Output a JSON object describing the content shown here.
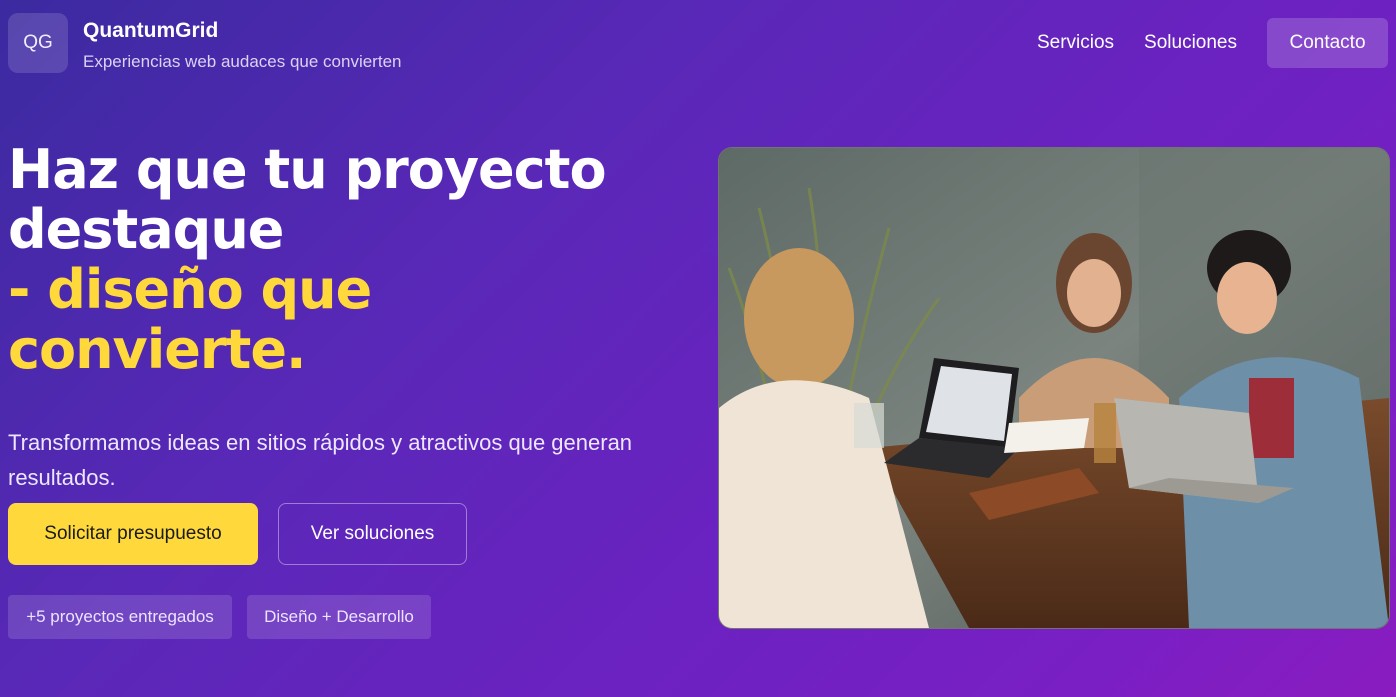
{
  "brand": {
    "logo_text": "QG",
    "name": "QuantumGrid",
    "tagline": "Experiencias web audaces que convierten"
  },
  "nav": {
    "items": [
      "Servicios",
      "Soluciones"
    ],
    "contact_label": "Contacto"
  },
  "hero": {
    "title_line1": "Haz que tu proyecto",
    "title_line2": "destaque",
    "highlight_line1": "- diseño que",
    "highlight_line2": "convierte.",
    "subtitle": "Transformamos ideas en sitios rápidos y atractivos que generan resultados.",
    "primary_cta": "Solicitar presupuesto",
    "secondary_cta": "Ver soluciones",
    "chips": [
      "+5 proyectos entregados",
      "Diseño + Desarrollo"
    ],
    "image_icon": "team-photo"
  },
  "colors": {
    "accent_yellow": "#ffd93b",
    "gradient_start": "#3b2aa0",
    "gradient_end": "#8a1cc0"
  }
}
